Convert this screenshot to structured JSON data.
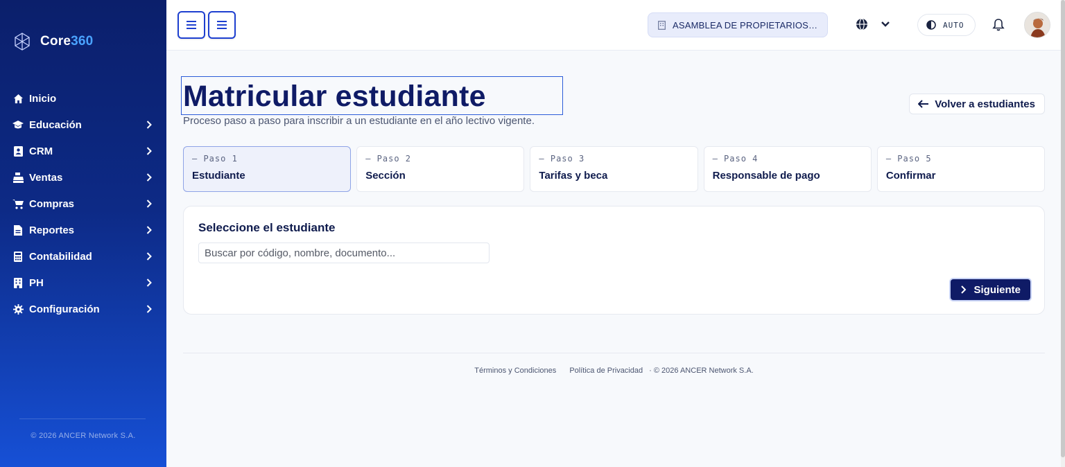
{
  "brand": {
    "name_main": "Core",
    "name_accent": "360"
  },
  "sidebar": {
    "items": [
      {
        "label": "Inicio",
        "icon": "home-icon",
        "has_children": false
      },
      {
        "label": "Educación",
        "icon": "graduation-cap-icon",
        "has_children": true
      },
      {
        "label": "CRM",
        "icon": "address-book-icon",
        "has_children": true
      },
      {
        "label": "Ventas",
        "icon": "cash-register-icon",
        "has_children": true
      },
      {
        "label": "Compras",
        "icon": "shopping-cart-icon",
        "has_children": true
      },
      {
        "label": "Reportes",
        "icon": "file-report-icon",
        "has_children": true
      },
      {
        "label": "Contabilidad",
        "icon": "calculator-icon",
        "has_children": true
      },
      {
        "label": "PH",
        "icon": "building-icon",
        "has_children": true
      },
      {
        "label": "Configuración",
        "icon": "gear-icon",
        "has_children": true
      }
    ],
    "footer": "© 2026 ANCER Network S.A."
  },
  "topbar": {
    "organization": "ASAMBLEA DE PROPIETARIOS DE ...",
    "theme_label": "AUTO"
  },
  "page": {
    "title": "Matricular estudiante",
    "subtitle": "Proceso paso a paso para inscribir a un estudiante en el año lectivo vigente.",
    "back_label": "Volver a estudiantes"
  },
  "steps": [
    {
      "number": "— Paso 1",
      "label": "Estudiante",
      "active": true
    },
    {
      "number": "— Paso 2",
      "label": "Sección",
      "active": false
    },
    {
      "number": "— Paso 3",
      "label": "Tarifas y beca",
      "active": false
    },
    {
      "number": "— Paso 4",
      "label": "Responsable de pago",
      "active": false
    },
    {
      "number": "— Paso 5",
      "label": "Confirmar",
      "active": false
    }
  ],
  "card": {
    "title": "Seleccione el estudiante",
    "search_placeholder": "Buscar por código, nombre, documento...",
    "next_label": "Siguiente"
  },
  "footer": {
    "terms": "Términos y Condiciones",
    "privacy": "Política de Privacidad",
    "copyright": "· © 2026 ANCER Network S.A."
  },
  "colors": {
    "primary": "#0f1b66",
    "accent": "#1d3fd0",
    "sidebar_top": "#0b1f6b",
    "sidebar_bottom": "#1650d6"
  }
}
